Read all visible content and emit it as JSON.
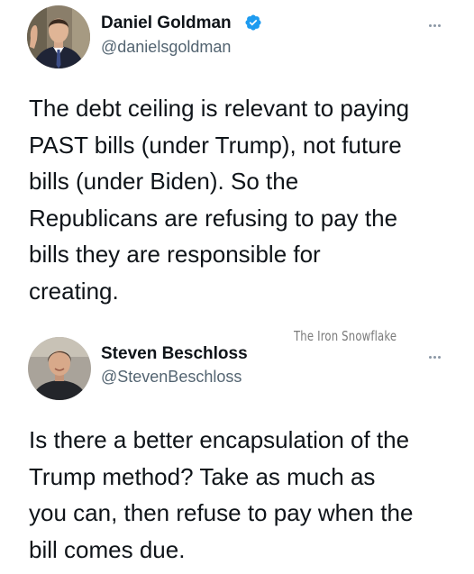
{
  "tweets": [
    {
      "author": {
        "display_name": "Daniel Goldman",
        "handle": "@danielsgoldman",
        "verified": true,
        "avatar_icon": "avatar-man-in-suit"
      },
      "more_icon": "more-horizontal-icon",
      "text": "The debt ceiling is relevant to paying\nPAST bills (under Trump), not future\nbills (under Biden). So the\nRepublicans are refusing to pay the\nbills they are responsible for\ncreating."
    },
    {
      "author": {
        "display_name": "Steven Beschloss",
        "handle": "@StevenBeschloss",
        "verified": false,
        "avatar_icon": "avatar-man-portrait"
      },
      "more_icon": "more-horizontal-icon",
      "text": "Is there a better encapsulation of the\nTrump method? Take as much as\nyou can, then refuse to pay when the\nbill comes due."
    }
  ],
  "watermark": "The Iron Snowflake",
  "colors": {
    "text_primary": "#0f1419",
    "text_secondary": "#536471",
    "verified_blue": "#1d9bf0",
    "watermark_gray": "#7a7a7a"
  }
}
